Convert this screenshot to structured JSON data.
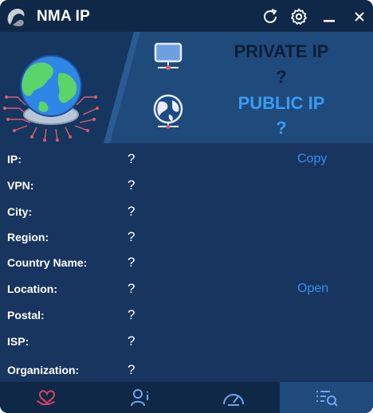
{
  "app": {
    "title": "NMA IP"
  },
  "banner": {
    "private_label": "PRIVATE IP",
    "private_value": "?",
    "public_label": "PUBLIC IP",
    "public_value": "?"
  },
  "info_rows": [
    {
      "label": "IP:",
      "value": "?",
      "action": "Copy"
    },
    {
      "label": "VPN:",
      "value": "?"
    },
    {
      "label": "City:",
      "value": "?"
    },
    {
      "label": "Region:",
      "value": "?"
    },
    {
      "label": "Country Name:",
      "value": "?"
    },
    {
      "label": "Location:",
      "value": "?",
      "action": "Open"
    },
    {
      "label": "Postal:",
      "value": "?"
    },
    {
      "label": "ISP:",
      "value": "?"
    },
    {
      "label": "Organization:",
      "value": "?"
    }
  ],
  "nav": [
    {
      "icon": "heart-hand-icon",
      "active": false
    },
    {
      "icon": "user-info-icon",
      "active": false
    },
    {
      "icon": "speedometer-icon",
      "active": false
    },
    {
      "icon": "list-search-icon",
      "active": true
    }
  ],
  "colors": {
    "titlebar": "#0f2848",
    "window": "#18355f",
    "banner": "#1f4a7c",
    "accent": "#3a9bf3",
    "nav_heart": "#e0435a",
    "nav_icon": "#6fa6ec"
  }
}
